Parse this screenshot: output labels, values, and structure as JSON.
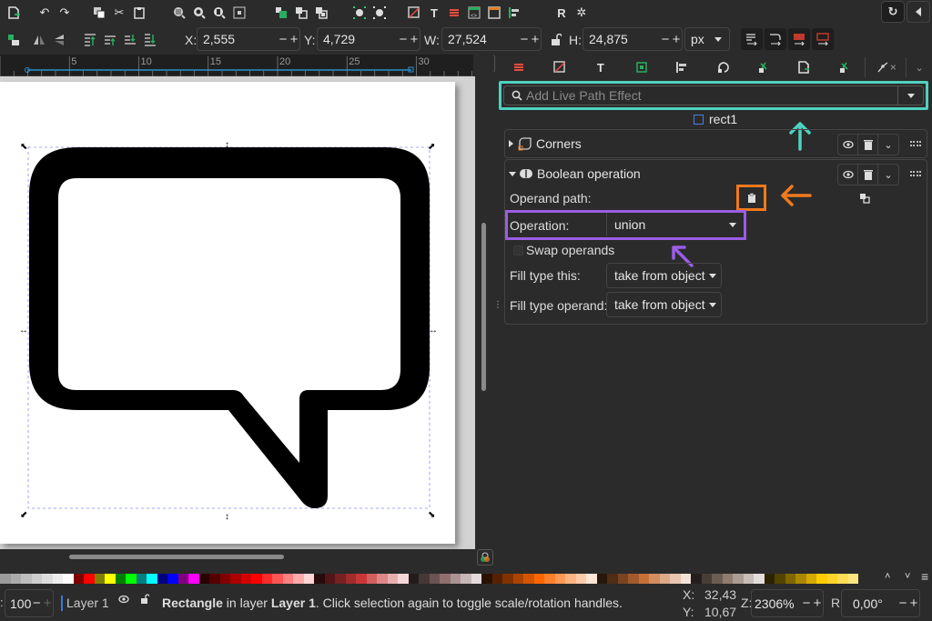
{
  "toolbar_commands": {
    "icons": [
      "new-document-icon",
      "undo-icon",
      "redo-icon",
      "duplicate-icon",
      "cut-icon",
      "paste-icon",
      "zoom-selection-icon",
      "zoom-drawing-icon",
      "zoom-page-icon",
      "zoom-center-icon",
      "group-icon",
      "lock-icon",
      "unlock-icon",
      "select-all-icon",
      "deselect-icon",
      "fill-stroke-icon",
      "text-font-icon",
      "layers-icon",
      "xml-editor-icon",
      "document-properties-icon",
      "align-distribute-icon",
      "find-replace-icon",
      "preferences-icon"
    ]
  },
  "top_right": {
    "snap_icon": "snap-toggle-icon",
    "collapse_icon": "collapse-left-icon"
  },
  "toolbar_select": {
    "x_label": "X:",
    "x_value": "2,555",
    "y_label": "Y:",
    "y_value": "4,729",
    "w_label": "W:",
    "w_value": "27,524",
    "h_label": "H:",
    "h_value": "24,875",
    "unit": "px",
    "minus": "−",
    "plus": "+"
  },
  "ruler": {
    "ticks": [
      "5",
      "10",
      "15",
      "20",
      "25",
      "30"
    ]
  },
  "panel": {
    "tabs": [
      "layers-icon",
      "fill-stroke-icon",
      "text-icon",
      "export-icon",
      "align-icon",
      "transform-icon",
      "lpe-icon",
      "document-icon",
      "path-effects-icon",
      "node-icon"
    ],
    "tab_close": "×",
    "search_placeholder": "Add Live Path Effect",
    "object_name": "rect1",
    "effects": [
      {
        "name": "Corners",
        "expanded": false
      },
      {
        "name": "Boolean operation",
        "expanded": true
      }
    ],
    "boolean": {
      "operand_label": "Operand path:",
      "operation_label": "Operation:",
      "operation_value": "union",
      "swap_label": "Swap operands",
      "swap_checked": false,
      "fill_this_label": "Fill type this:",
      "fill_this_value": "take from object",
      "fill_operand_label": "Fill type operand:",
      "fill_operand_value": "take from object"
    },
    "annotations": {
      "search_arrow_color": "#4fd1c0",
      "paste_box_color": "#f07a1c",
      "operation_box_color": "#9b5de5"
    }
  },
  "palette": {
    "colors": [
      "#9a9a9a",
      "#ababab",
      "#bdbdbd",
      "#cecece",
      "#dedede",
      "#eeeeee",
      "#ffffff",
      "#800000",
      "#ff0000",
      "#808000",
      "#ffff00",
      "#008000",
      "#00ff00",
      "#008080",
      "#00ffff",
      "#000080",
      "#0000ff",
      "#800080",
      "#ff00ff",
      "#2b0000",
      "#550000",
      "#800000",
      "#aa0000",
      "#d40000",
      "#ff0000",
      "#ff2a2a",
      "#ff5555",
      "#ff8080",
      "#ffaaaa",
      "#ffd5d5",
      "#280b0b",
      "#501616",
      "#782121",
      "#a02c2c",
      "#c83737",
      "#d35f5f",
      "#de8787",
      "#e9afaf",
      "#f4d7d7",
      "#241c1c",
      "#483737",
      "#6c5353",
      "#916f6f",
      "#ac9393",
      "#c8b7b7",
      "#e3dbdb",
      "#2b1100",
      "#552200",
      "#803300",
      "#aa4400",
      "#d45500",
      "#ff6600",
      "#ff7f2a",
      "#ff9955",
      "#ffb380",
      "#ffccaa",
      "#ffe6d5",
      "#28170b",
      "#502d16",
      "#784421",
      "#a05a2c",
      "#c87137",
      "#d38d5f",
      "#deaa87",
      "#e9c6af",
      "#f4e3d7",
      "#241f1c",
      "#483e37",
      "#6c5d53",
      "#917c6f",
      "#ac9d93",
      "#c8beb7",
      "#e3dedb",
      "#2b2200",
      "#554400",
      "#806600",
      "#aa8800",
      "#d4aa00",
      "#ffcc00",
      "#ffd42a",
      "#ffdd55",
      "#ffe680"
    ],
    "scroll_up": "^",
    "scroll_down": "v",
    "menu": "≡"
  },
  "status": {
    "opacity_label": ":",
    "opacity_value": "100",
    "layer_name": "Layer 1",
    "message_bold": "Rectangle",
    "message_mid": " in layer ",
    "message_layer": "Layer 1",
    "message_tail": ". Click selection again to toggle scale/rotation handles.",
    "cursor_x_label": "X:",
    "cursor_x": "32,43",
    "cursor_y_label": "Y:",
    "cursor_y": "10,67",
    "zoom_label": "Z:",
    "zoom_value": "2306%",
    "rotate_label": "R:",
    "rotate_value": "0,00°"
  }
}
